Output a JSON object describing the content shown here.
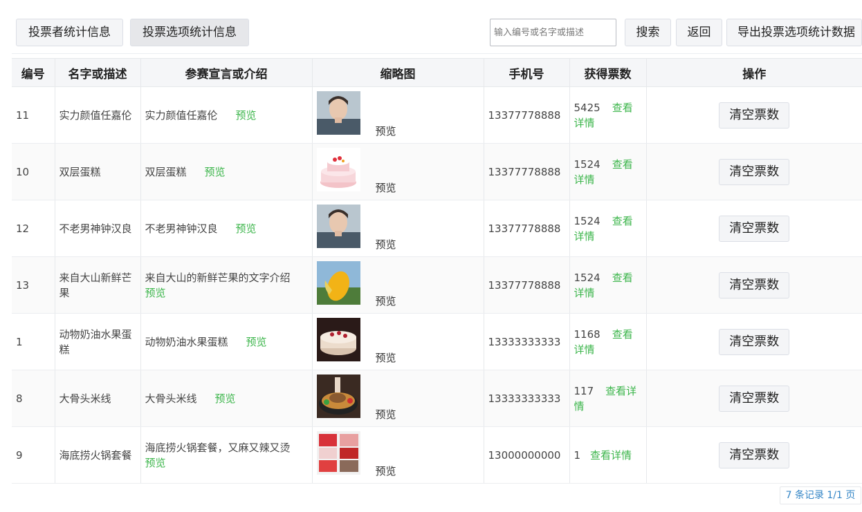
{
  "toolbar": {
    "voter_stats_label": "投票者统计信息",
    "option_stats_label": "投票选项统计信息",
    "search_placeholder": "输入编号或名字或描述",
    "search_label": "搜索",
    "back_label": "返回",
    "export_label": "导出投票选项统计数据"
  },
  "table": {
    "headers": [
      "编号",
      "名字或描述",
      "参赛宣言或介绍",
      "缩略图",
      "手机号",
      "获得票数",
      "操作"
    ],
    "rows": [
      {
        "id": "11",
        "name": "实力颜值任嘉伦",
        "intro": "实力颜值任嘉伦",
        "intro_link": "预览",
        "thumb_link": "预览",
        "thumb_icon": "portrait-thumbnail-icon",
        "phone": "13377778888",
        "votes": "5425",
        "detail_link": "查看详情",
        "action": "清空票数"
      },
      {
        "id": "10",
        "name": "双层蛋糕",
        "intro": "双层蛋糕",
        "intro_link": "预览",
        "thumb_link": "预览",
        "thumb_icon": "cake-thumbnail-icon",
        "phone": "13377778888",
        "votes": "1524",
        "detail_link": "查看详情",
        "action": "清空票数"
      },
      {
        "id": "12",
        "name": "不老男神钟汉良",
        "intro": "不老男神钟汉良",
        "intro_link": "预览",
        "thumb_link": "预览",
        "thumb_icon": "portrait-thumbnail-icon",
        "phone": "13377778888",
        "votes": "1524",
        "detail_link": "查看详情",
        "action": "清空票数"
      },
      {
        "id": "13",
        "name": "来自大山新鲜芒果",
        "intro": "来自大山的新鲜芒果的文字介绍",
        "intro_link": "预览",
        "thumb_link": "预览",
        "thumb_icon": "mango-thumbnail-icon",
        "phone": "13377778888",
        "votes": "1524",
        "detail_link": "查看详情",
        "action": "清空票数"
      },
      {
        "id": "1",
        "name": "动物奶油水果蛋糕",
        "intro": "动物奶油水果蛋糕",
        "intro_link": "预览",
        "thumb_link": "预览",
        "thumb_icon": "cream-cake-thumbnail-icon",
        "phone": "13333333333",
        "votes": "1168",
        "detail_link": "查看详情",
        "action": "清空票数"
      },
      {
        "id": "8",
        "name": "大骨头米线",
        "intro": "大骨头米线",
        "intro_link": "预览",
        "thumb_link": "预览",
        "thumb_icon": "noodle-thumbnail-icon",
        "phone": "13333333333",
        "votes": "117",
        "detail_link": "查看详情",
        "action": "清空票数"
      },
      {
        "id": "9",
        "name": "海底捞火锅套餐",
        "intro": "海底捞火锅套餐，又麻又辣又烫",
        "intro_link": "预览",
        "thumb_link": "预览",
        "thumb_icon": "hotpot-thumbnail-icon",
        "phone": "13000000000",
        "votes": "1",
        "detail_link": "查看详情",
        "action": "清空票数"
      }
    ]
  },
  "pagination": {
    "summary": "7 条记录 1/1 页"
  },
  "colors": {
    "link_green": "#3bb54a",
    "pager_blue": "#3385c6",
    "button_bg": "#f4f5f7"
  }
}
